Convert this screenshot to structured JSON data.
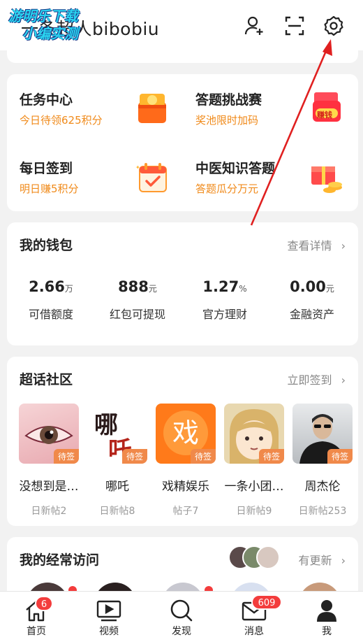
{
  "header": {
    "username": "一条超人bibobiu",
    "watermark_line1": "游明乐下载",
    "watermark_line2": "小编实测",
    "icons": [
      "add-user-icon",
      "scan-icon",
      "settings-icon"
    ]
  },
  "tasks": [
    {
      "title": "任务中心",
      "subtitle": "今日待领625积分",
      "icon": "coin-box-icon"
    },
    {
      "title": "答题挑战赛",
      "subtitle": "奖池限时加码",
      "icon": "red-envelope-icon",
      "icon_text": "赚钱"
    },
    {
      "title": "每日签到",
      "subtitle": "明日赚5积分",
      "icon": "calendar-check-icon"
    },
    {
      "title": "中医知识答题",
      "subtitle": "答题瓜分万元",
      "icon": "gift-coins-icon"
    }
  ],
  "wallet": {
    "title": "我的钱包",
    "link": "查看详情",
    "stats": [
      {
        "value": "2.66",
        "unit": "万",
        "label": "可借额度"
      },
      {
        "value": "888",
        "unit": "元",
        "label": "红包可提现"
      },
      {
        "value": "1.27",
        "unit": "%",
        "label": "官方理财"
      },
      {
        "value": "0.00",
        "unit": "元",
        "label": "金融资产"
      }
    ]
  },
  "super_topics": {
    "title": "超话社区",
    "link": "立即签到",
    "items": [
      {
        "name": "没想到是…",
        "sub": "日新帖2",
        "tag": "待签"
      },
      {
        "name": "哪吒",
        "sub": "日新帖8",
        "tag": "待签"
      },
      {
        "name": "戏精娱乐",
        "sub": "帖子7",
        "tag": "待签",
        "img_text": "戏"
      },
      {
        "name": "一条小团…",
        "sub": "日新帖9",
        "tag": "待签"
      },
      {
        "name": "周杰伦",
        "sub": "日新帖253",
        "tag": "待签"
      }
    ]
  },
  "frequent": {
    "title": "我的经常访问",
    "link": "有更新"
  },
  "bottom_nav": [
    {
      "label": "首页",
      "icon": "home-icon",
      "badge": "6"
    },
    {
      "label": "视频",
      "icon": "video-icon",
      "badge": ""
    },
    {
      "label": "发现",
      "icon": "search-icon",
      "badge": ""
    },
    {
      "label": "消息",
      "icon": "message-icon",
      "badge": "609"
    },
    {
      "label": "我",
      "icon": "profile-icon",
      "badge": ""
    }
  ],
  "colors": {
    "accent_orange": "#f08a1a",
    "badge_red": "#f33c3c",
    "arrow_red": "#e02020"
  }
}
